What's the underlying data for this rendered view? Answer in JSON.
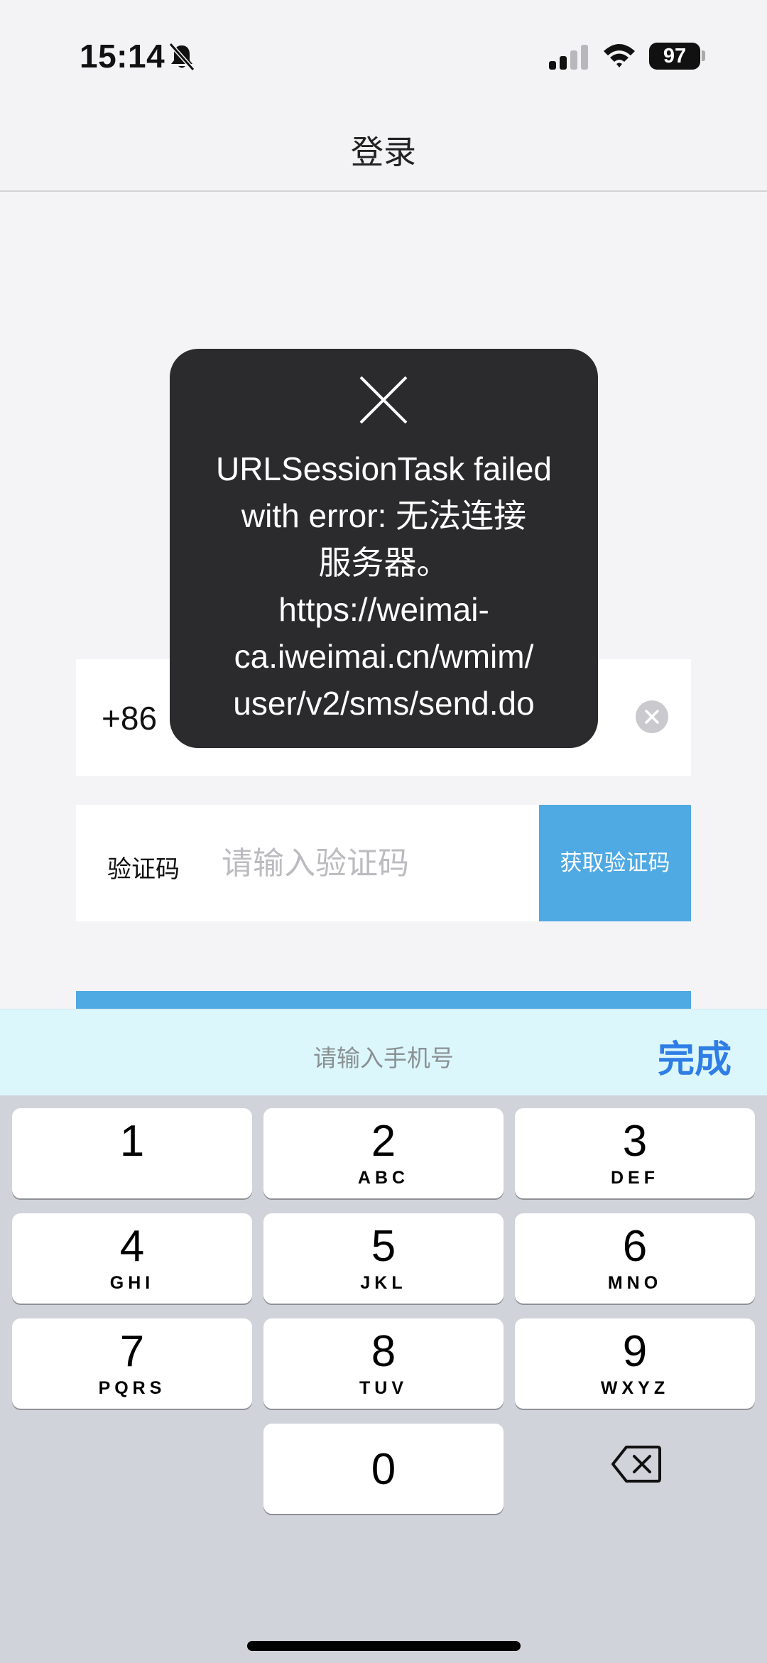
{
  "status_bar": {
    "time": "15:14",
    "battery": "97",
    "icons": [
      "bell-slash-icon",
      "cellular-signal-icon",
      "wifi-icon",
      "battery-icon"
    ]
  },
  "nav": {
    "title": "登录"
  },
  "form": {
    "country_code": "+86",
    "code_label": "验证码",
    "code_placeholder": "请输入验证码",
    "get_code_label": "获取验证码"
  },
  "toast": {
    "icon": "close-icon",
    "lines": [
      "URLSessionTask failed",
      "with error: 无法连接",
      "服务器。",
      "https://weimai-",
      "ca.iweimai.cn/wmim/",
      "user/v2/sms/send.do"
    ]
  },
  "accessory": {
    "hint": "请输入手机号",
    "done_label": "完成"
  },
  "keypad": {
    "keys": [
      {
        "digit": "1",
        "letters": ""
      },
      {
        "digit": "2",
        "letters": "ABC"
      },
      {
        "digit": "3",
        "letters": "DEF"
      },
      {
        "digit": "4",
        "letters": "GHI"
      },
      {
        "digit": "5",
        "letters": "JKL"
      },
      {
        "digit": "6",
        "letters": "MNO"
      },
      {
        "digit": "7",
        "letters": "PQRS"
      },
      {
        "digit": "8",
        "letters": "TUV"
      },
      {
        "digit": "9",
        "letters": "WXYZ"
      },
      {
        "digit": "0",
        "letters": ""
      }
    ],
    "delete_icon": "delete-backspace-icon"
  },
  "colors": {
    "accent_blue": "#4fa9e3",
    "done_blue": "#2f7ee6",
    "toast_bg": "#2b2b2d",
    "accessory_bg": "#dcf7fb",
    "keypad_bg": "#d1d3da"
  }
}
